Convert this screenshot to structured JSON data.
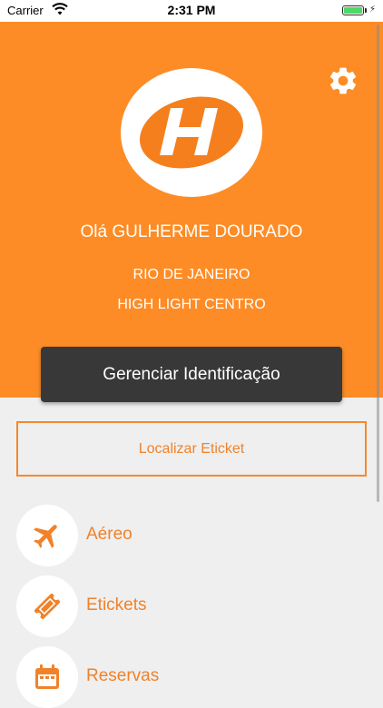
{
  "status_bar": {
    "carrier": "Carrier",
    "time": "2:31 PM",
    "battery_level": 1.0
  },
  "header": {
    "background_color": "#fd8c26",
    "settings_icon": "gear-icon",
    "logo_icon": "company-logo",
    "greeting": "Olá GULHERME DOURADO",
    "city": "RIO DE JANEIRO",
    "branch": "HIGH LIGHT CENTRO",
    "manage_button_label": "Gerenciar Identificação"
  },
  "main": {
    "locate_button_label": "Localizar Eticket",
    "menu_items": [
      {
        "label": "Aéreo",
        "icon": "airplane-icon"
      },
      {
        "label": "Etickets",
        "icon": "ticket-icon"
      },
      {
        "label": "Reservas",
        "icon": "calendar-icon"
      }
    ]
  },
  "colors": {
    "accent": "#f0822a",
    "dark_button": "#383838",
    "background": "#efefef"
  }
}
